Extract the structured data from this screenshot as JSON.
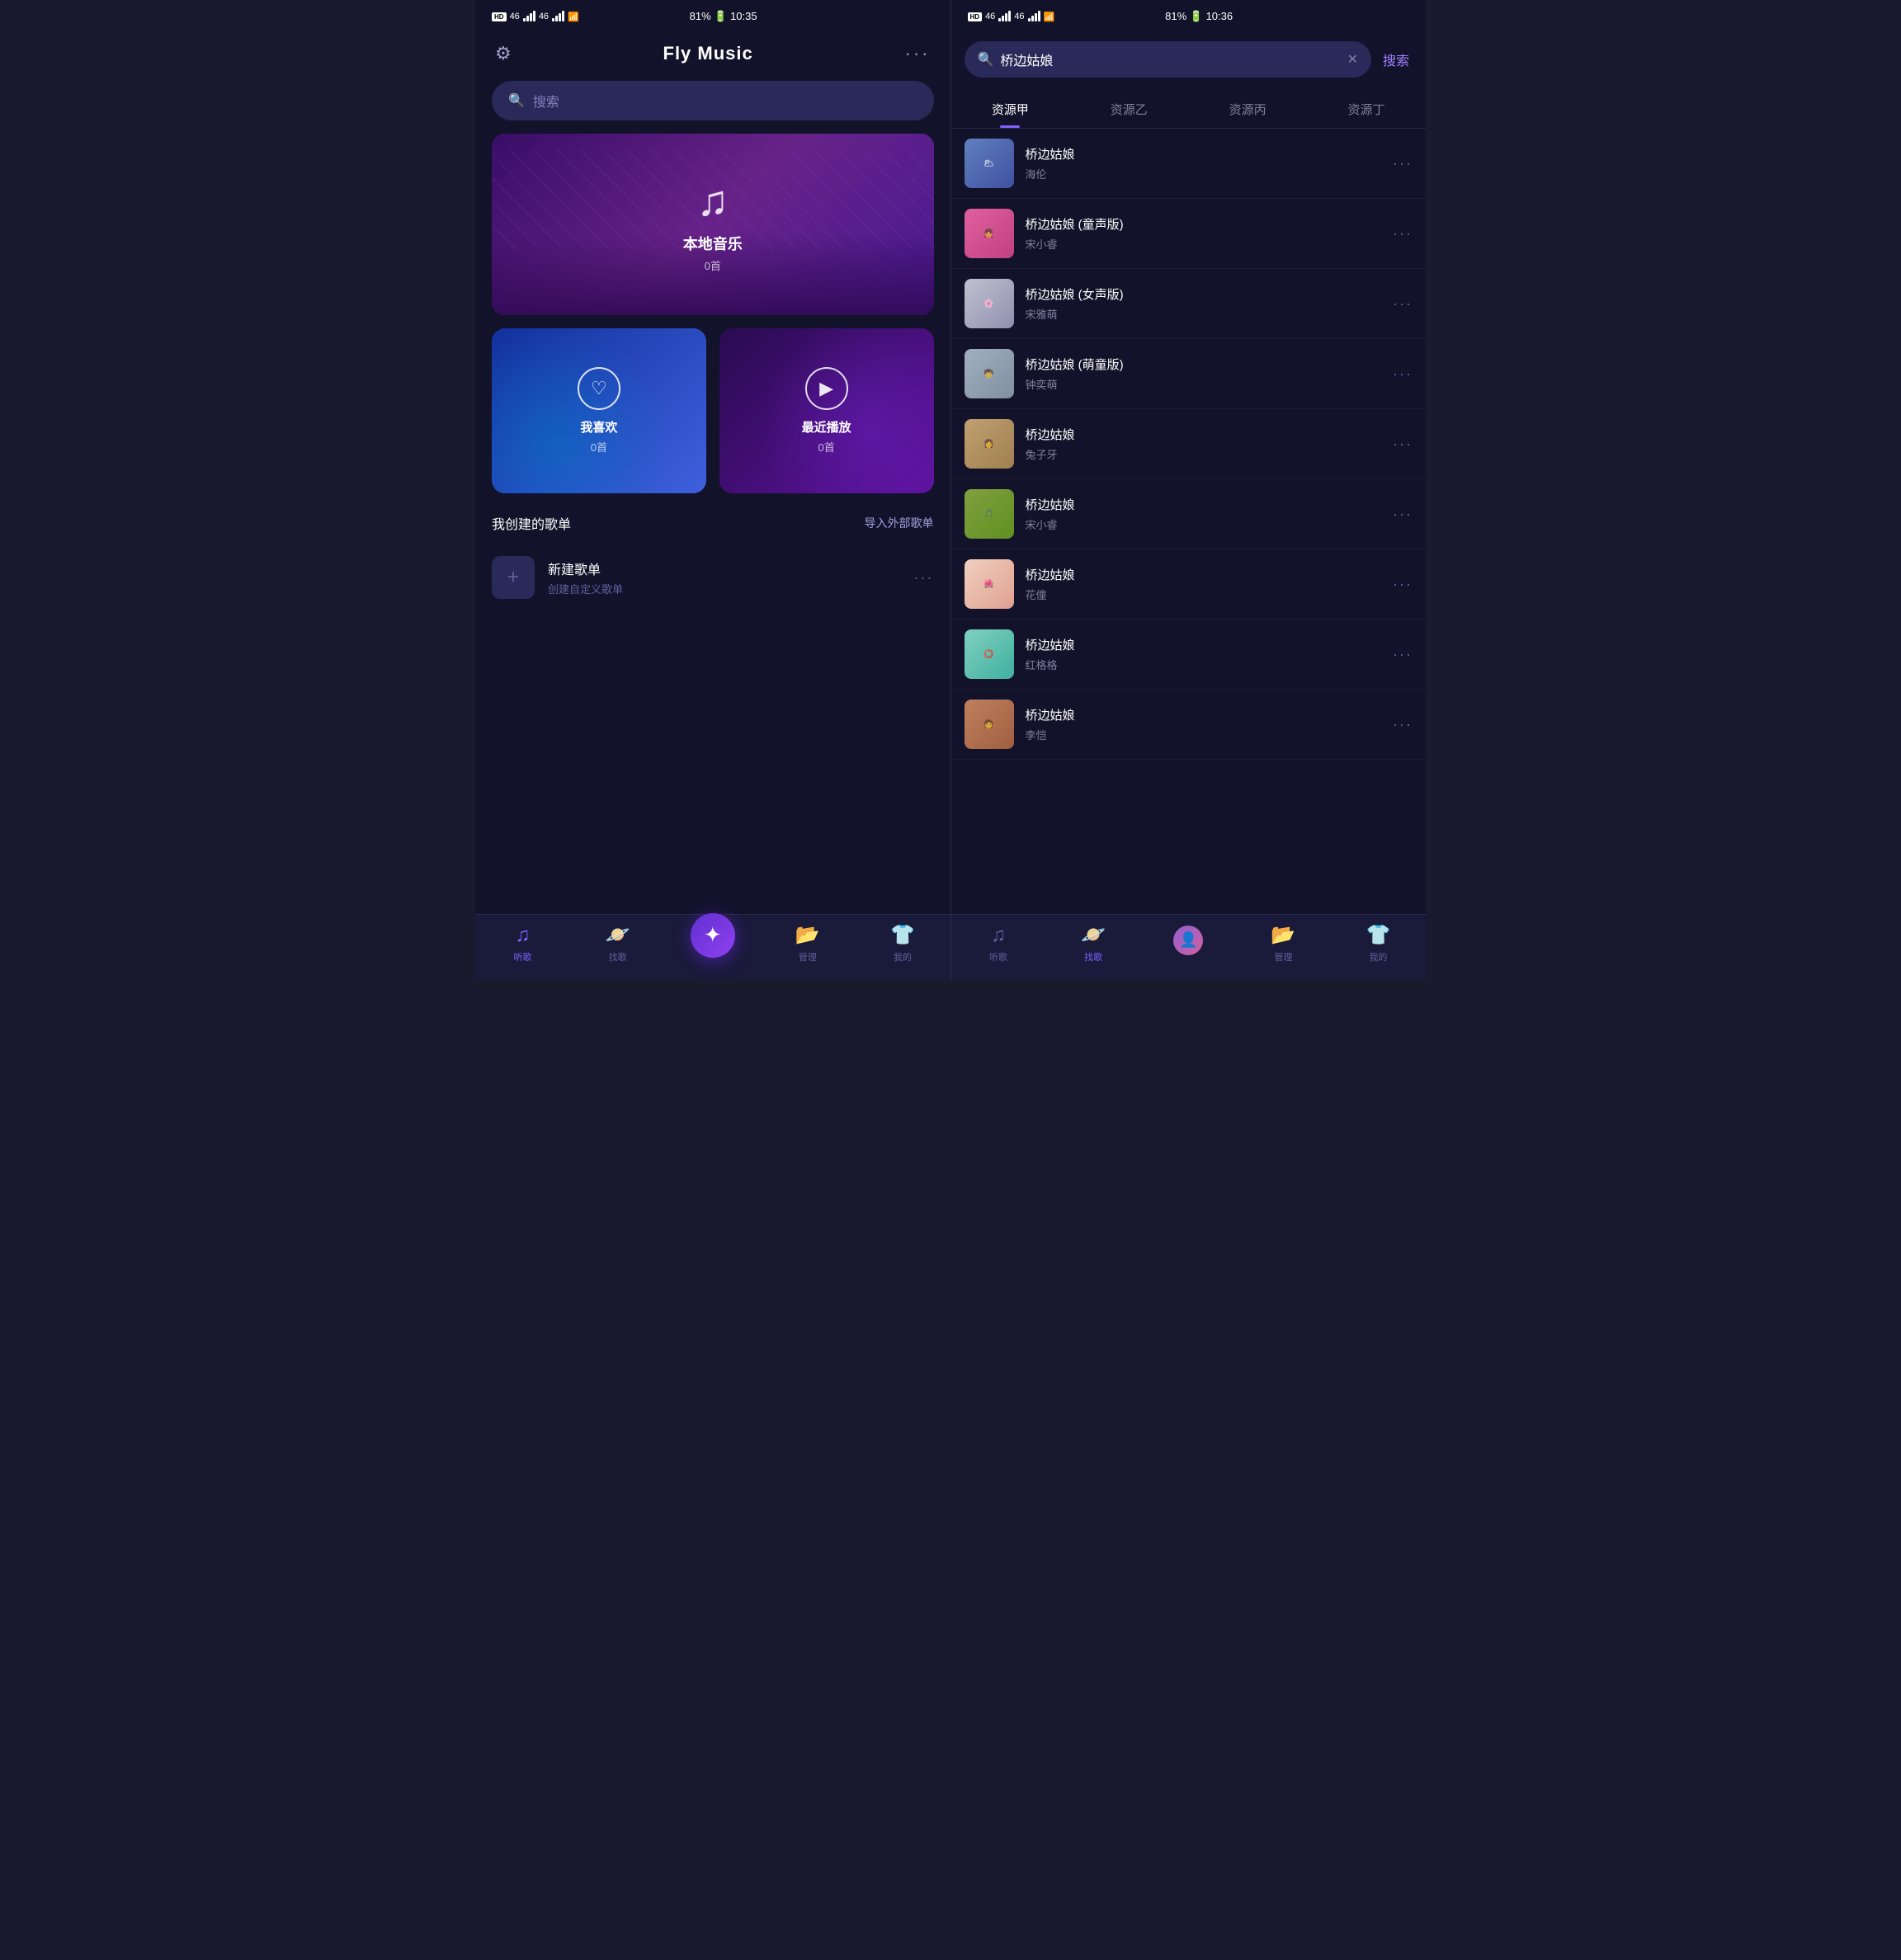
{
  "leftPhone": {
    "statusBar": {
      "left": "HD 46 46 ▲",
      "battery": "81%",
      "time": "10:35"
    },
    "header": {
      "settingsIcon": "⚙",
      "title": "Fly Music",
      "moreIcon": "···"
    },
    "searchBar": {
      "placeholder": "搜索",
      "icon": "🔍"
    },
    "mainCard": {
      "icon": "♫",
      "title": "本地音乐",
      "subtitle": "0首"
    },
    "smallCards": [
      {
        "id": "favorites",
        "title": "我喜欢",
        "subtitle": "0首",
        "icon": "♡"
      },
      {
        "id": "recent",
        "title": "最近播放",
        "subtitle": "0首",
        "icon": "▶"
      }
    ],
    "sectionTitle": "我创建的歌单",
    "sectionAction": "导入外部歌单",
    "playlist": {
      "name": "新建歌单",
      "desc": "创建自定义歌单",
      "icon": "+"
    },
    "bottomNav": [
      {
        "id": "listen",
        "label": "听歌",
        "icon": "♫",
        "active": true
      },
      {
        "id": "find",
        "label": "找歌",
        "icon": "⊙",
        "active": false
      },
      {
        "id": "center",
        "label": "",
        "icon": "✦",
        "active": false
      },
      {
        "id": "manage",
        "label": "管理",
        "icon": "📁",
        "active": false
      },
      {
        "id": "mine",
        "label": "我的",
        "icon": "👕",
        "active": false
      }
    ]
  },
  "rightPhone": {
    "statusBar": {
      "battery": "81%",
      "time": "10:36"
    },
    "searchQuery": "桥边姑娘",
    "searchButton": "搜索",
    "sourceTabs": [
      {
        "id": "jia",
        "label": "资源甲",
        "active": true
      },
      {
        "id": "yi",
        "label": "资源乙",
        "active": false
      },
      {
        "id": "bing",
        "label": "资源丙",
        "active": false
      },
      {
        "id": "ding",
        "label": "资源丁",
        "active": false
      }
    ],
    "results": [
      {
        "id": 1,
        "title": "桥边姑娘",
        "artist": "海伦",
        "thumb": "thumb-1"
      },
      {
        "id": 2,
        "title": "桥边姑娘 (童声版)",
        "artist": "宋小睿",
        "thumb": "thumb-2"
      },
      {
        "id": 3,
        "title": "桥边姑娘 (女声版)",
        "artist": "宋雅萌",
        "thumb": "thumb-3"
      },
      {
        "id": 4,
        "title": "桥边姑娘 (萌童版)",
        "artist": "钟奕萌",
        "thumb": "thumb-4"
      },
      {
        "id": 5,
        "title": "桥边姑娘",
        "artist": "兔子牙",
        "thumb": "thumb-5"
      },
      {
        "id": 6,
        "title": "桥边姑娘",
        "artist": "宋小睿",
        "thumb": "thumb-6"
      },
      {
        "id": 7,
        "title": "桥边姑娘",
        "artist": "花僮",
        "thumb": "thumb-7"
      },
      {
        "id": 8,
        "title": "桥边姑娘",
        "artist": "红格格",
        "thumb": "thumb-8"
      },
      {
        "id": 9,
        "title": "桥边姑娘",
        "artist": "李恺",
        "thumb": "thumb-9"
      }
    ],
    "bottomNav": [
      {
        "id": "listen",
        "label": "听歌",
        "icon": "♫",
        "active": false
      },
      {
        "id": "find",
        "label": "找歌",
        "icon": "⊙",
        "active": true
      },
      {
        "id": "center",
        "label": "",
        "icon": "avatar",
        "active": false
      },
      {
        "id": "manage",
        "label": "管理",
        "icon": "📁",
        "active": false
      },
      {
        "id": "mine",
        "label": "我的",
        "icon": "👕",
        "active": false
      }
    ]
  }
}
